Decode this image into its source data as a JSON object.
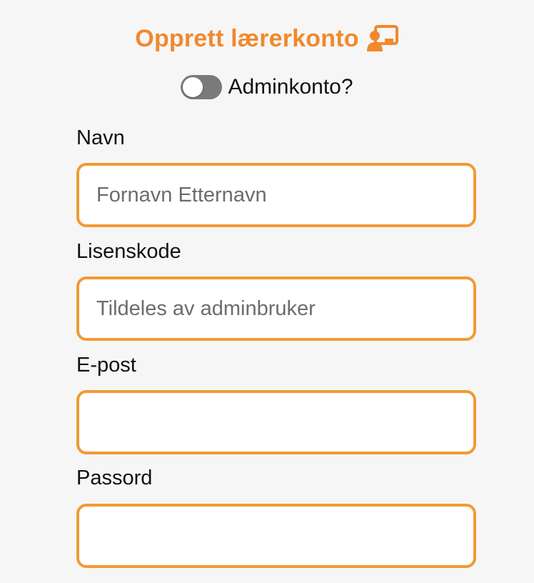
{
  "header": {
    "title": "Opprett lærerkonto",
    "title_icon": "chalkboard-teacher-icon",
    "accent_color": "#f0892e"
  },
  "admin_toggle": {
    "label": "Adminkonto?",
    "checked": false
  },
  "form": {
    "fields": [
      {
        "label": "Navn",
        "value": "",
        "placeholder": "Fornavn Etternavn"
      },
      {
        "label": "Lisenskode",
        "value": "",
        "placeholder": "Tildeles av adminbruker"
      },
      {
        "label": "E-post",
        "value": "",
        "placeholder": ""
      },
      {
        "label": "Passord",
        "value": "",
        "placeholder": ""
      }
    ],
    "border_color": "#f19a33"
  }
}
